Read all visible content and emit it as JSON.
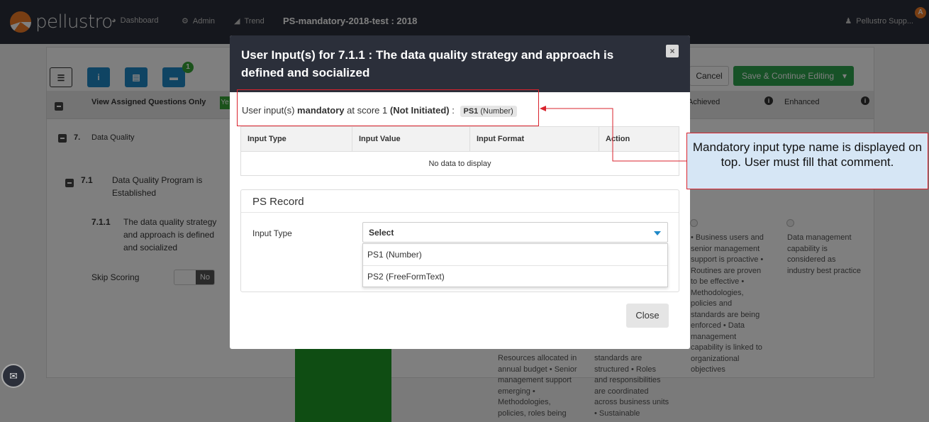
{
  "brand": {
    "name": "pellustro",
    "accent": "#f07c27"
  },
  "nav": {
    "dashboard": "Dashboard",
    "admin": "Admin",
    "trend": "Trend",
    "assessment_title": "PS-mandatory-2018-test : 2018",
    "user": "Pellustro Supp...",
    "user_badge": "A"
  },
  "toolbar": {
    "badge_count": "1",
    "cancel": "Cancel",
    "save": "Save & Continue Editing"
  },
  "background": {
    "view_assigned": "View Assigned Questions Only",
    "view_assigned_toggle": "Ye",
    "col_achieved": "Achieved",
    "col_enhanced": "Enhanced",
    "section_num": "7.",
    "section_name": "Data Quality",
    "sub_num": "7.1",
    "sub_name": "Data Quality Program is Established",
    "q_num": "7.1.1",
    "q_text": "The data quality strategy and approach is defined and socialized",
    "skip_label": "Skip Scoring",
    "skip_value": "No",
    "achieved_desc": "• Business users and senior management support is proactive • Routines are proven to be effective • Methodologies, policies and standards are being enforced • Data management capability is linked to organizational objectives",
    "enhanced_desc": "Data management capability is considered as industry best practice",
    "col3_desc": "Resources allocated in annual budget • Senior management support emerging • Methodologies, policies, roles being",
    "col4_desc": "standards are structured • Roles and responsibilities are coordinated across business units • Sustainable"
  },
  "modal": {
    "title": "User Input(s) for 7.1.1 : The data quality strategy and approach is defined and socialized",
    "close_x": "×",
    "mandatory_prefix": "User input(s)",
    "mandatory_word": "mandatory",
    "mandatory_mid": "at score 1",
    "mandatory_status": "(Not Initiated)",
    "mandatory_colon": ":",
    "mandatory_tag_code": "PS1",
    "mandatory_tag_type": "(Number)",
    "table_headers": [
      "Input Type",
      "Input Value",
      "Input Format",
      "Action"
    ],
    "table_empty": "No data to display",
    "record_title": "PS Record",
    "input_type_label": "Input Type",
    "select_value": "Select",
    "options": [
      "PS1 (Number)",
      "PS2 (FreeFormText)"
    ],
    "close_button": "Close"
  },
  "annotation": {
    "callout": "Mandatory input type name is displayed on top. User must fill that comment.",
    "color": "#d9232d"
  }
}
